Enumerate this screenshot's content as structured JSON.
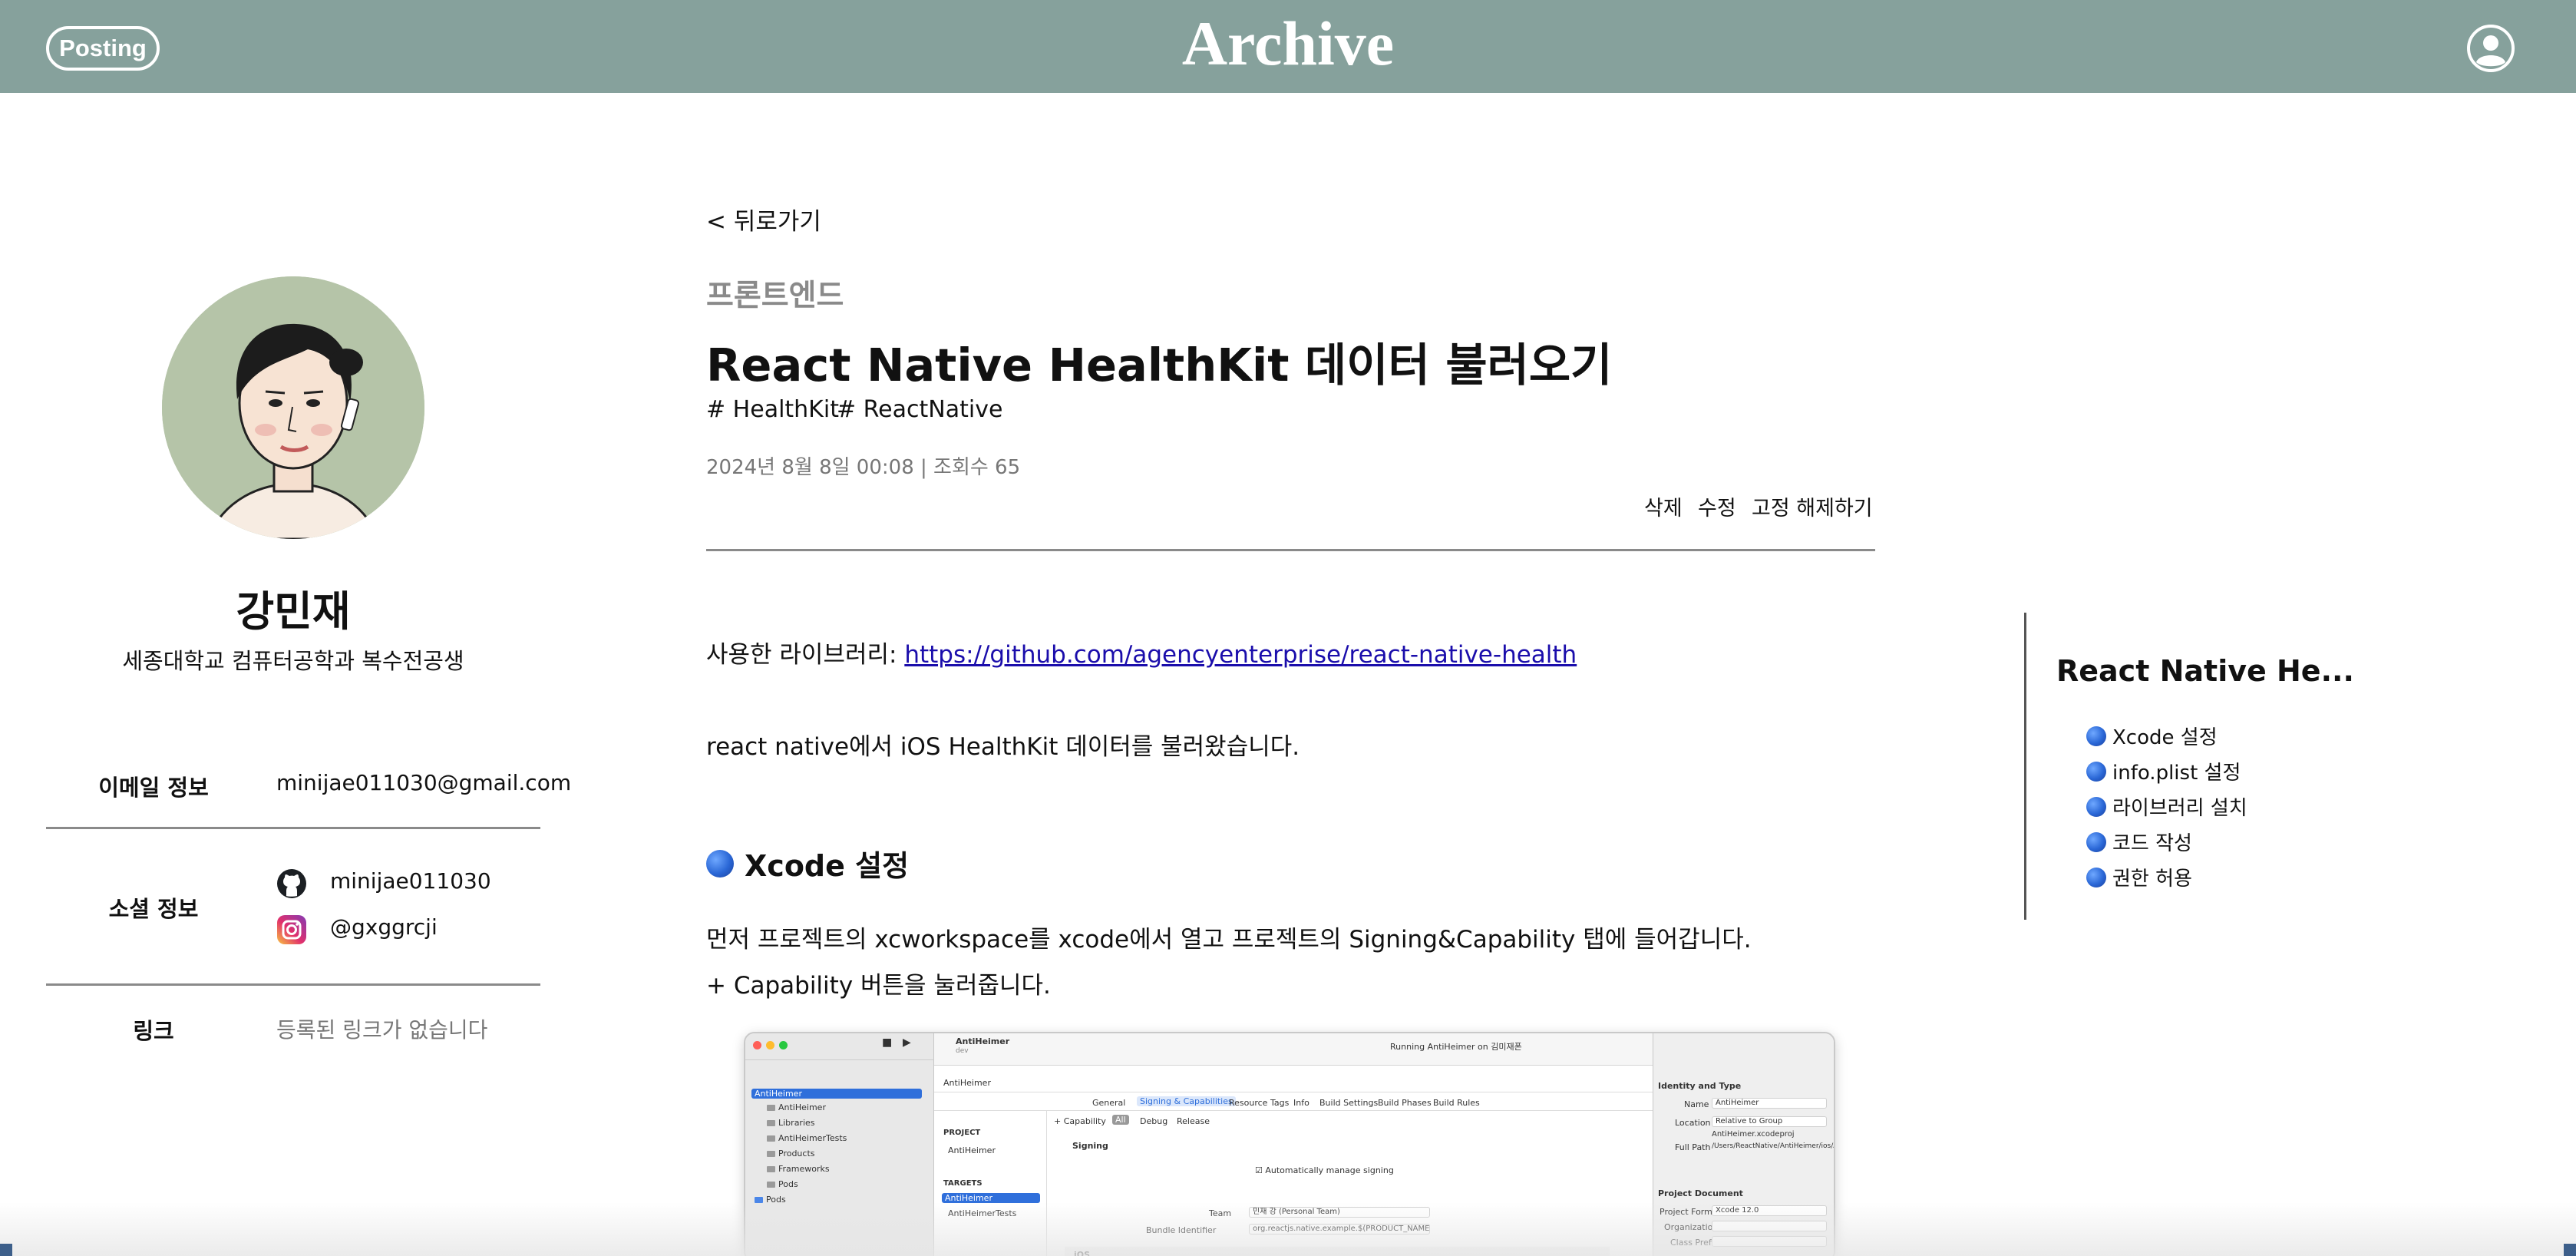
{
  "header": {
    "posting_label": "Posting",
    "site_title": "Archive"
  },
  "profile": {
    "name": "강민재",
    "description": "세종대학교 컴퓨터공학과 복수전공생",
    "email_label": "이메일 정보",
    "email_value": "minijae011030@gmail.com",
    "social_label": "소셜 정보",
    "github": "minijae011030",
    "instagram": "@gxggrcji",
    "link_label": "링크",
    "link_value": "등록된 링크가 없습니다"
  },
  "post": {
    "back_label": "< 뒤로가기",
    "category": "프론트엔드",
    "title": "React Native HealthKit 데이터 불러오기",
    "tags": [
      "# HealthKit",
      "# ReactNative"
    ],
    "meta": "2024년 8월 8일 00:08 | 조회수 65",
    "actions": {
      "delete": "삭제",
      "edit": "수정",
      "unpin": "고정 해제하기"
    },
    "library_prefix": "사용한 라이브러리: ",
    "library_url": "https://github.com/agencyenterprise/react-native-health",
    "intro": "react native에서 iOS HealthKit 데이터를 불러왔습니다.",
    "section_heading": "Xcode 설정",
    "para1": "먼저 프로젝트의 xcworkspace를 xcode에서 열고 프로젝트의 Signing&Capability 탭에 들어갑니다.",
    "para2": "+ Capability 버튼을 눌러줍니다."
  },
  "xcode": {
    "project_name": "AntiHeimer",
    "branch": "dev",
    "running": "Running AntiHeimer on 김미재폰",
    "tree": [
      "AntiHeimer",
      "AntiHeimer",
      "Libraries",
      "AntiHeimerTests",
      "Products",
      "Frameworks",
      "Pods",
      "Pods"
    ],
    "tabs": [
      "General",
      "Signing & Capabilities",
      "Resource Tags",
      "Info",
      "Build Settings",
      "Build Phases",
      "Build Rules"
    ],
    "sub_tabs": [
      "+ Capability",
      "All",
      "Debug",
      "Release"
    ],
    "project_section": "PROJECT",
    "targets_section": "TARGETS",
    "target_selected": "AntiHeimer",
    "target_tests": "AntiHeimerTests",
    "signing": "Signing",
    "auto_signing": "Automatically manage signing",
    "team_label": "Team",
    "team_value": "민재 강 (Personal Team)",
    "bundle_label": "Bundle Identifier",
    "bundle_value": "org.reactjs.native.example.$(PRODUCT_NAME:rfc",
    "ios": "iOS",
    "inspector_title": "Identity and Type",
    "name_label": "Name",
    "name_value": "AntiHeimer",
    "location_label": "Location",
    "location_value": "Relative to Group",
    "file_value": "AntiHeimer.xcodeproj",
    "fullpath_label": "Full Path",
    "fullpath_value": "/Users/ReactNative/AntiHeimer/ios/AntiHeimer.xcodeproj",
    "project_doc": "Project Document",
    "format_label": "Project Format",
    "format_value": "Xcode 12.0",
    "org_label": "Organization",
    "prefix_label": "Class Prefix"
  },
  "toc": {
    "title": "React Native He...",
    "items": [
      "Xcode 설정",
      "info.plist 설정",
      "라이브러리 설치",
      "코드 작성",
      "권한 허용"
    ]
  },
  "colors": {
    "header_bg": "#86a19c",
    "link": "#1a0dab",
    "bullet": "#2a67d6"
  }
}
